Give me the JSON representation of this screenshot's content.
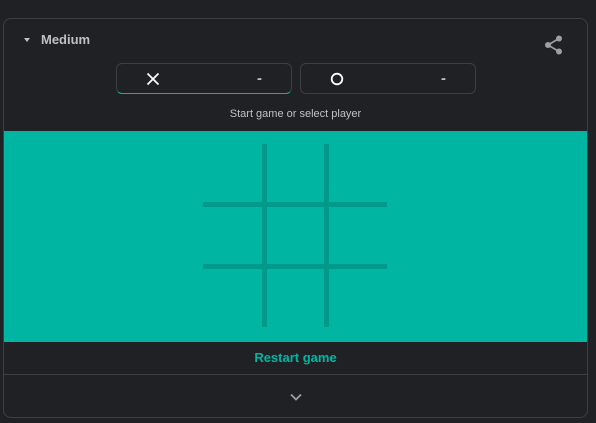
{
  "header": {
    "difficulty_label": "Medium",
    "difficulty_icon": "caret-down-icon",
    "share_icon": "share-icon"
  },
  "players": [
    {
      "symbol": "X",
      "icon": "x-mark-icon",
      "score": "-",
      "active": true
    },
    {
      "symbol": "O",
      "icon": "o-mark-icon",
      "score": "-",
      "active": false
    }
  ],
  "status_text": "Start game or select player",
  "board": {
    "cells": [
      "",
      "",
      "",
      "",
      "",
      "",
      "",
      "",
      ""
    ]
  },
  "restart_label": "Restart game",
  "expand_icon": "chevron-down-icon",
  "colors": {
    "background": "#202124",
    "board": "#00b5a2",
    "grid_lines": "#019a8a",
    "accent": "#00b5a2",
    "text": "#bdc1c6"
  }
}
